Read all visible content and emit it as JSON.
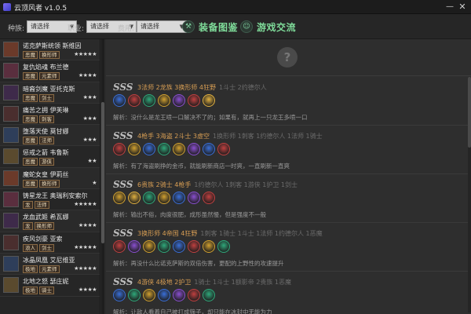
{
  "window": {
    "title": "云顶风者 v1.0.5",
    "minimize_glyph": "—",
    "close_glyph": "✕"
  },
  "toolbar": {
    "filters": [
      {
        "label": "种族:",
        "value": "请选择"
      },
      {
        "label": "职业:",
        "value": "请选择"
      },
      {
        "label": "费用:",
        "value": "请选择"
      }
    ],
    "nav": [
      {
        "label": "装备图鉴",
        "icon": "wrench-icon"
      },
      {
        "label": "游戏交流",
        "icon": "person-icon"
      }
    ]
  },
  "heroes": [
    {
      "name": "诺克萨斯统领 斯维因",
      "tags": [
        "恶魔",
        "换形师"
      ],
      "stars": "★★★★★"
    },
    {
      "name": "复仇焰魂 布兰德",
      "tags": [
        "恶魔",
        "元素师"
      ],
      "stars": "★★★★"
    },
    {
      "name": "暗裔剑魔 亚托克斯",
      "tags": [
        "恶魔",
        "剑士"
      ],
      "stars": "★★★"
    },
    {
      "name": "痛苦之拥 伊芙琳",
      "tags": [
        "恶魔",
        "刺客"
      ],
      "stars": "★★★"
    },
    {
      "name": "堕落天使 莫甘娜",
      "tags": [
        "恶魔",
        "法师"
      ],
      "stars": "★★★"
    },
    {
      "name": "惩戒之箭 韦鲁斯",
      "tags": [
        "恶魔",
        "游侠"
      ],
      "stars": "★★"
    },
    {
      "name": "魔蛇女皇 伊莉丝",
      "tags": [
        "恶魔",
        "换形师"
      ],
      "stars": "★"
    },
    {
      "name": "铸星龙王 奥瑞利安索尔",
      "tags": [
        "龙",
        "法师"
      ],
      "stars": "★★★★★"
    },
    {
      "name": "龙血武姬 希瓦娜",
      "tags": [
        "龙",
        "换形师"
      ],
      "stars": "★★★★"
    },
    {
      "name": "疾风剑豪 亚索",
      "tags": [
        "浪人",
        "剑士"
      ],
      "stars": "★★★★★"
    },
    {
      "name": "冰晶凤凰 艾尼维亚",
      "tags": [
        "极地",
        "元素师"
      ],
      "stars": "★★★★★"
    },
    {
      "name": "北地之怒 瑟庄妮",
      "tags": [
        "极地",
        "骑士"
      ],
      "stars": "★★★★"
    }
  ],
  "main": {
    "help_glyph": "?",
    "comps": [
      {
        "tier": "SSS",
        "synergy": "3法师 2龙族 3换形师 4狂野",
        "sub": "1斗士 2约德尔人",
        "champ_colors": [
          "#3a6fd8",
          "#c04040",
          "#2fa87a",
          "#d0a030",
          "#8a4fd0",
          "#c04040",
          "#e0b040"
        ],
        "desc": "解析：没什么是龙王喷一口解决不了的；如果有，就再上一只龙王多喷一口"
      },
      {
        "tier": "SSS",
        "synergy": "4枪手 3海盗 2斗士 3虚空",
        "sub": "1换形师 1刺客 1约德尔人 1法师 1骑士",
        "champ_colors": [
          "#c04040",
          "#d0a030",
          "#3a6fd8",
          "#2fa87a",
          "#d0a030",
          "#8a4fd0",
          "#3a6fd8",
          "#c04040"
        ],
        "desc": "解析：有了海盗刷挣的金币，就能刷新商店一时爽，一直刷新一直爽"
      },
      {
        "tier": "SSS",
        "synergy": "6贵族 2骑士 4枪手",
        "sub": "1约德尔人 1刺客 1游侠 1护卫 1剑士",
        "champ_colors": [
          "#d0a030",
          "#e0b040",
          "#2fa87a",
          "#d0a030",
          "#3a6fd8",
          "#8a4fd0",
          "#c04040"
        ],
        "desc": "解析：输出不俗，肉度很肥，成形虽然慢，但是强度不一般"
      },
      {
        "tier": "SSS",
        "synergy": "3换形师 4帝国 4狂野",
        "sub": "1刺客 1骑士 1斗士 1法师 1约德尔人 1恶魔",
        "champ_colors": [
          "#c04040",
          "#8a4fd0",
          "#d0a030",
          "#2fa87a",
          "#3a6fd8",
          "#c04040",
          "#d0a030",
          "#2fa87a"
        ],
        "desc": "解析：再没什么比诺克萨斯的双倍伤害，更配的上野性的攻速提升"
      },
      {
        "tier": "SSS",
        "synergy": "4游侠 4极地 2护卫",
        "sub": "1骑士 1斗士 1额影帝 2贵族 1恶魔",
        "champ_colors": [
          "#3a6fd8",
          "#2fa87a",
          "#d0a030",
          "#3a6fd8",
          "#8a4fd0",
          "#c04040",
          "#2fa87a"
        ],
        "desc": "解析：让敌人看着自己被打成筛子，却只能在冰封中无能为力"
      }
    ]
  }
}
